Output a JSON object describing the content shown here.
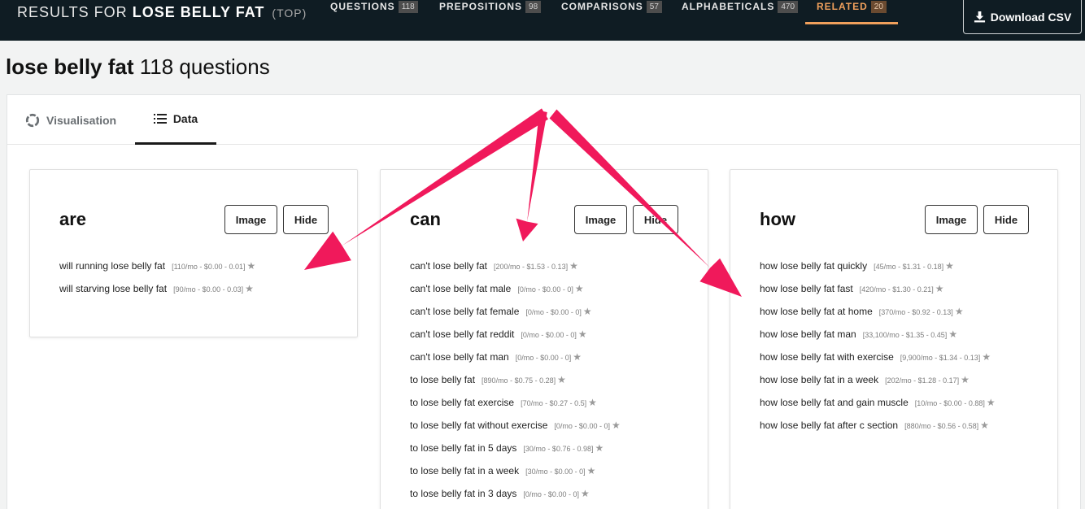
{
  "header": {
    "results_prefix": "RESULTS FOR",
    "query": "LOSE BELLY FAT",
    "mode": "(TOP)",
    "nav": [
      {
        "label": "QUESTIONS",
        "count": "118"
      },
      {
        "label": "PREPOSITIONS",
        "count": "98"
      },
      {
        "label": "COMPARISONS",
        "count": "57"
      },
      {
        "label": "ALPHABETICALS",
        "count": "470"
      },
      {
        "label": "RELATED",
        "count": "20"
      }
    ],
    "download_label": "Download CSV"
  },
  "page": {
    "keyword": "lose belly fat",
    "count_text": "118 questions"
  },
  "view_tabs": {
    "visualisation": "Visualisation",
    "data": "Data"
  },
  "cards": [
    {
      "title": "are",
      "image_label": "Image",
      "hide_label": "Hide",
      "items": [
        {
          "text": "will running lose belly fat",
          "meta": "[110/mo - $0.00 - 0.01]"
        },
        {
          "text": "will starving lose belly fat",
          "meta": "[90/mo - $0.00 - 0.03]"
        }
      ]
    },
    {
      "title": "can",
      "image_label": "Image",
      "hide_label": "Hide",
      "items": [
        {
          "text": "can't lose belly fat",
          "meta": "[200/mo - $1.53 - 0.13]"
        },
        {
          "text": "can't lose belly fat male",
          "meta": "[0/mo - $0.00 - 0]"
        },
        {
          "text": "can't lose belly fat female",
          "meta": "[0/mo - $0.00 - 0]"
        },
        {
          "text": "can't lose belly fat reddit",
          "meta": "[0/mo - $0.00 - 0]"
        },
        {
          "text": "can't lose belly fat man",
          "meta": "[0/mo - $0.00 - 0]"
        },
        {
          "text": "to lose belly fat",
          "meta": "[890/mo - $0.75 - 0.28]"
        },
        {
          "text": "to lose belly fat exercise",
          "meta": "[70/mo - $0.27 - 0.5]"
        },
        {
          "text": "to lose belly fat without exercise",
          "meta": "[0/mo - $0.00 - 0]"
        },
        {
          "text": "to lose belly fat in 5 days",
          "meta": "[30/mo - $0.76 - 0.98]"
        },
        {
          "text": "to lose belly fat in a week",
          "meta": "[30/mo - $0.00 - 0]"
        },
        {
          "text": "to lose belly fat in 3 days",
          "meta": "[0/mo - $0.00 - 0]"
        }
      ]
    },
    {
      "title": "how",
      "image_label": "Image",
      "hide_label": "Hide",
      "items": [
        {
          "text": "how lose belly fat quickly",
          "meta": "[45/mo - $1.31 - 0.18]"
        },
        {
          "text": "how lose belly fat fast",
          "meta": "[420/mo - $1.30 - 0.21]"
        },
        {
          "text": "how lose belly fat at home",
          "meta": "[370/mo - $0.92 - 0.13]"
        },
        {
          "text": "how lose belly fat man",
          "meta": "[33,100/mo - $1.35 - 0.45]"
        },
        {
          "text": "how lose belly fat with exercise",
          "meta": "[9,900/mo - $1.34 - 0.13]"
        },
        {
          "text": "how lose belly fat in a week",
          "meta": "[202/mo - $1.28 - 0.17]"
        },
        {
          "text": "how lose belly fat and gain muscle",
          "meta": "[10/mo - $0.00 - 0.88]"
        },
        {
          "text": "how lose belly fat after c section",
          "meta": "[880/mo - $0.56 - 0.58]"
        }
      ]
    }
  ],
  "colors": {
    "topbar": "#0f1c23",
    "accent": "#f0a05c",
    "arrow": "#f0195b"
  }
}
